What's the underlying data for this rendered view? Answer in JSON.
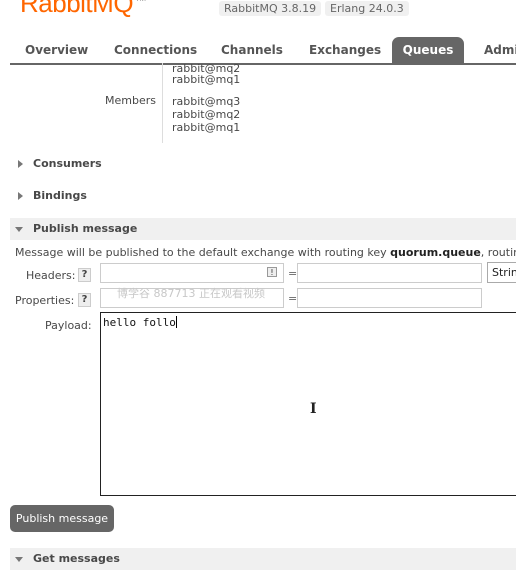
{
  "header": {
    "logo_text": "RabbitMQ",
    "trademark": "TM",
    "rabbitmq_version": "RabbitMQ 3.8.19",
    "erlang_version": "Erlang 24.0.3"
  },
  "tabs": [
    {
      "label": "Overview",
      "active": false
    },
    {
      "label": "Connections",
      "active": false
    },
    {
      "label": "Channels",
      "active": false
    },
    {
      "label": "Exchanges",
      "active": false
    },
    {
      "label": "Queues",
      "active": true
    },
    {
      "label": "Admin",
      "active": false
    }
  ],
  "details": {
    "prev_members": [
      "rabbit@mq2",
      "rabbit@mq1"
    ],
    "members_label": "Members",
    "members": [
      "rabbit@mq3",
      "rabbit@mq2",
      "rabbit@mq1"
    ]
  },
  "sections": {
    "consumers": "Consumers",
    "bindings": "Bindings",
    "publish": "Publish message",
    "get": "Get messages"
  },
  "publish": {
    "hint_prefix": "Message will be published to the default exchange with routing key ",
    "routing_key": "quorum.queue",
    "hint_suffix": ", routing",
    "headers_label": "Headers:",
    "properties_label": "Properties:",
    "help_glyph": "?",
    "equals": "=",
    "type_select": "String",
    "payload_label": "Payload:",
    "payload_value": "hello follo",
    "button_label": "Publish message"
  },
  "overlay": {
    "watermark": "博学谷 887713 正在观看视频"
  },
  "colors": {
    "brand": "#ff6600",
    "tab_active": "#666666",
    "section_bg": "#f0f0f0"
  }
}
